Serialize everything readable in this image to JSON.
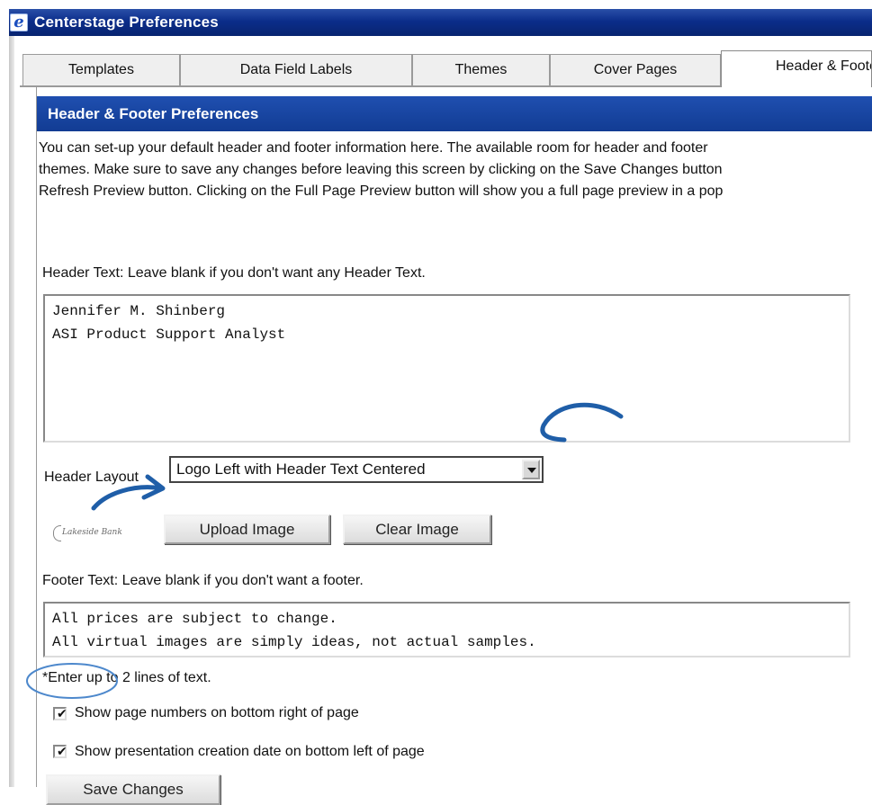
{
  "window": {
    "title": "Centerstage Preferences",
    "icon": "e-app-icon"
  },
  "tabs": [
    {
      "label": "Templates",
      "active": false
    },
    {
      "label": "Data Field Labels",
      "active": false
    },
    {
      "label": "Themes",
      "active": false
    },
    {
      "label": "Cover Pages",
      "active": false
    },
    {
      "label": "Header & Footer",
      "active": true
    }
  ],
  "section": {
    "title": "Header & Footer Preferences",
    "intro_lines": [
      "You can set-up your default header and footer information here. The available room for header and footer",
      "themes. Make sure to save any changes before leaving this screen by clicking on the Save Changes button",
      "Refresh Preview button. Clicking on the Full Page Preview button will show you a full page preview in a pop"
    ]
  },
  "header": {
    "label": "Header Text: Leave blank if you don't want any Header Text.",
    "text": "Jennifer M. Shinberg\nASI Product Support Analyst",
    "layout_label": "Header Layout",
    "layout_value": "Logo Left with Header Text Centered",
    "logo_text": "Lakeside Bank",
    "upload_button": "Upload Image",
    "clear_button": "Clear Image"
  },
  "footer": {
    "label": "Footer Text: Leave blank if you don't want a footer.",
    "text": "All prices are subject to change.\nAll virtual images are simply ideas, not actual samples.",
    "note": "*Enter up to 2 lines of text."
  },
  "options": {
    "page_numbers": {
      "label": "Show page numbers on bottom right of page",
      "checked": true
    },
    "creation_date": {
      "label": "Show presentation creation date on bottom left of page",
      "checked": true
    }
  },
  "save_button": "Save Changes",
  "colors": {
    "titlebar": "#0b2d8a",
    "section_header": "#1a46a3",
    "annotation": "#1f5ea8"
  }
}
